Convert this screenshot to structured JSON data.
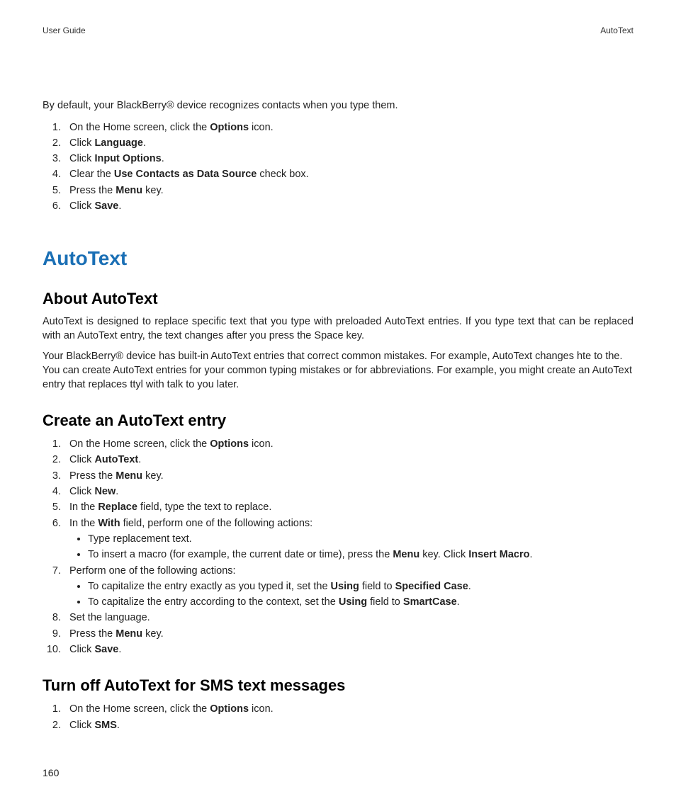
{
  "header": {
    "left": "User Guide",
    "right": "AutoText"
  },
  "intro_paragraph": "By default, your BlackBerry® device recognizes contacts when you type them.",
  "steps_top": [
    {
      "pre": "On the Home screen, click the ",
      "b": "Options",
      "post": " icon."
    },
    {
      "pre": "Click ",
      "b": "Language",
      "post": "."
    },
    {
      "pre": "Click ",
      "b": "Input Options",
      "post": "."
    },
    {
      "pre": "Clear the ",
      "b": "Use Contacts as Data Source",
      "post": " check box."
    },
    {
      "pre": "Press the ",
      "b": "Menu",
      "post": " key."
    },
    {
      "pre": "Click ",
      "b": "Save",
      "post": "."
    }
  ],
  "section_title": "AutoText",
  "about": {
    "heading": "About AutoText",
    "p1": "AutoText is designed to replace specific text that you type with preloaded AutoText entries. If you type text that can be replaced with an AutoText entry, the text changes after you press the Space key.",
    "p2": "Your BlackBerry® device has built-in AutoText entries that correct common mistakes. For example, AutoText changes hte to the. You can create AutoText entries for your common typing mistakes or for abbreviations. For example, you might create an AutoText entry that replaces ttyl with talk to you later."
  },
  "create": {
    "heading": "Create an AutoText entry",
    "steps": {
      "s1": {
        "pre": "On the Home screen, click the ",
        "b": "Options",
        "post": " icon."
      },
      "s2": {
        "pre": "Click ",
        "b": "AutoText",
        "post": "."
      },
      "s3": {
        "pre": "Press the ",
        "b": "Menu",
        "post": " key."
      },
      "s4": {
        "pre": "Click ",
        "b": "New",
        "post": "."
      },
      "s5": {
        "pre": "In the ",
        "b": "Replace",
        "post": " field, type the text to replace."
      },
      "s6": {
        "pre": "In the ",
        "b": "With",
        "post": " field, perform one of the following actions:"
      },
      "s6_bullets": {
        "b1": "Type replacement text.",
        "b2": {
          "pre": "To insert a macro (for example, the current date or time), press the ",
          "b1": "Menu",
          "mid": " key. Click ",
          "b2": "Insert Macro",
          "post": "."
        }
      },
      "s7": "Perform one of the following actions:",
      "s7_bullets": {
        "b1": {
          "pre": "To capitalize the entry exactly as you typed it, set the ",
          "b1": "Using",
          "mid": " field to ",
          "b2": "Specified Case",
          "post": "."
        },
        "b2": {
          "pre": "To capitalize the entry according to the context, set the ",
          "b1": "Using",
          "mid": " field to ",
          "b2": "SmartCase",
          "post": "."
        }
      },
      "s8": "Set the language.",
      "s9": {
        "pre": "Press the ",
        "b": "Menu",
        "post": " key."
      },
      "s10": {
        "pre": "Click ",
        "b": "Save",
        "post": "."
      }
    }
  },
  "turnoff": {
    "heading": "Turn off AutoText for SMS text messages",
    "steps": {
      "s1": {
        "pre": "On the Home screen, click the ",
        "b": "Options",
        "post": " icon."
      },
      "s2": {
        "pre": "Click ",
        "b": "SMS",
        "post": "."
      }
    }
  },
  "page_number": "160"
}
